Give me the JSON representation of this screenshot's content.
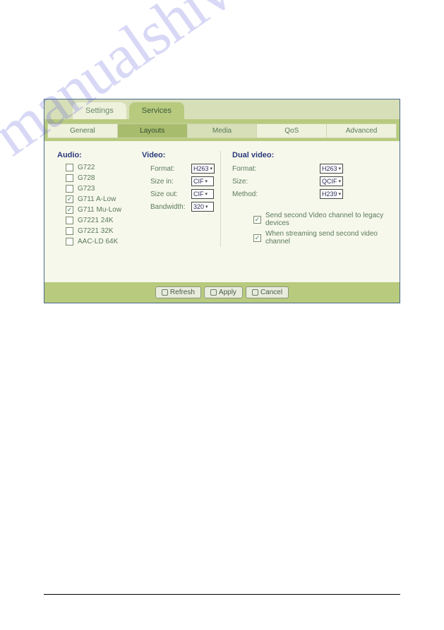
{
  "watermark": "manualshive.com",
  "topTabs": {
    "settings": "Settings",
    "services": "Services"
  },
  "subTabs": {
    "general": "General",
    "layouts": "Layouts",
    "media": "Media",
    "qos": "QoS",
    "advanced": "Advanced"
  },
  "audio": {
    "title": "Audio:",
    "items": [
      {
        "label": "G722",
        "checked": false
      },
      {
        "label": "G728",
        "checked": false
      },
      {
        "label": "G723",
        "checked": false
      },
      {
        "label": "G711 A-Low",
        "checked": true
      },
      {
        "label": "G711 Mu-Low",
        "checked": true
      },
      {
        "label": "G7221 24K",
        "checked": false
      },
      {
        "label": "G7221 32K",
        "checked": false
      },
      {
        "label": "AAC-LD 64K",
        "checked": false
      }
    ]
  },
  "video": {
    "title": "Video:",
    "format": {
      "label": "Format:",
      "value": "H263"
    },
    "sizeIn": {
      "label": "Size in:",
      "value": "CIF"
    },
    "sizeOut": {
      "label": "Size out:",
      "value": "CIF"
    },
    "bandwidth": {
      "label": "Bandwidth:",
      "value": "320"
    }
  },
  "dual": {
    "title": "Dual video:",
    "format": {
      "label": "Format:",
      "value": "H263"
    },
    "size": {
      "label": "Size:",
      "value": "QCIF"
    },
    "method": {
      "label": "Method:",
      "value": "H239"
    },
    "check1": {
      "label": "Send second Video channel to legacy devices",
      "checked": true
    },
    "check2": {
      "label": "When streaming send second video channel",
      "checked": true
    }
  },
  "buttons": {
    "refresh": "Refresh",
    "apply": "Apply",
    "cancel": "Cancel"
  }
}
